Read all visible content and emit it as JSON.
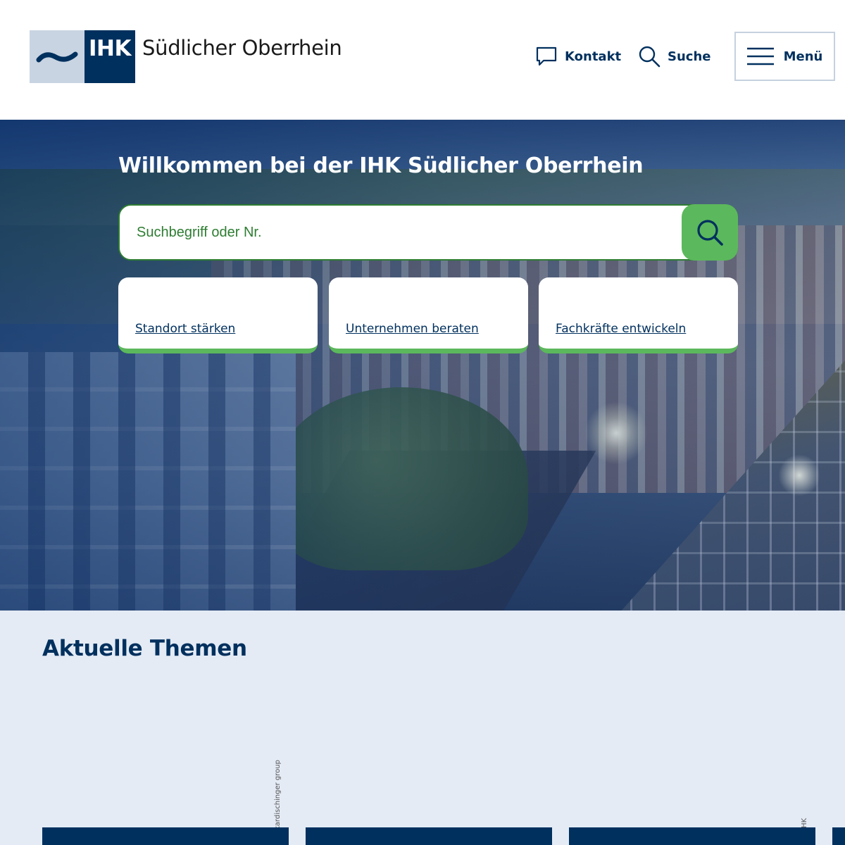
{
  "header": {
    "logo": {
      "mark_text": "IHK",
      "name": "Südlicher Oberrhein",
      "colors": {
        "navy": "#00305e",
        "light": "#c9d4e2"
      }
    },
    "nav": {
      "kontakt": {
        "label": "Kontakt",
        "icon": "chat-bubble-icon"
      },
      "suche": {
        "label": "Suche",
        "icon": "search-icon"
      }
    },
    "menu_button": {
      "label": "Menü",
      "icon": "hamburger-icon"
    }
  },
  "hero": {
    "title": "Willkommen bei der IHK Südlicher Oberrhein",
    "search": {
      "placeholder": "Suchbegriff oder Nr.",
      "value": "",
      "submit_icon": "search-icon"
    },
    "quick_links": [
      {
        "label": "Standort stärken"
      },
      {
        "label": "Unternehmen beraten"
      },
      {
        "label": "Fachkräfte entwickeln"
      }
    ]
  },
  "topics": {
    "title": "Aktuelle Themen",
    "credits": [
      "© kardischinger group",
      "© IHK"
    ]
  },
  "colors": {
    "brand_navy": "#00305e",
    "accent_green": "#5cb85c",
    "search_text_green": "#2e7d32",
    "topics_background": "#e4ebf5"
  }
}
